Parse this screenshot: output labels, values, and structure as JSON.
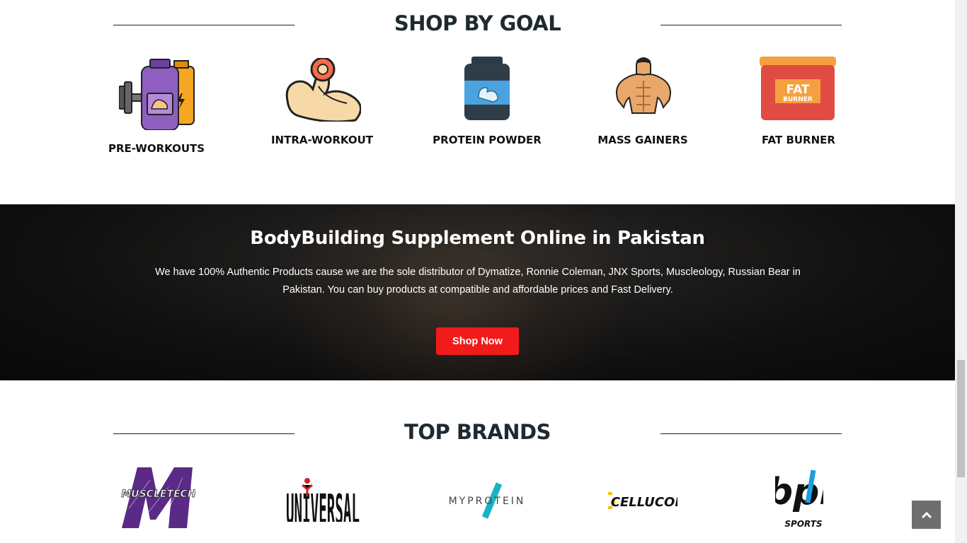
{
  "shop_by_goal": {
    "title": "SHOP BY GOAL",
    "items": [
      {
        "label": "PRE-WORKOUTS",
        "icon": "pre-workout-bottles-icon"
      },
      {
        "label": "INTRA-WORKOUT",
        "icon": "flexed-arm-icon"
      },
      {
        "label": "PROTEIN POWDER",
        "icon": "protein-tub-icon"
      },
      {
        "label": "MASS GAINERS",
        "icon": "bodybuilder-icon"
      },
      {
        "label": "FAT BURNER",
        "icon": "fat-burner-tub-icon",
        "icon_text_1": "FAT",
        "icon_text_2": "BURNER"
      }
    ]
  },
  "hero": {
    "title": "BodyBuilding Supplement Online in Pakistan",
    "description": "We have 100% Authentic Products cause we are the sole distributor of Dymatize, Ronnie Coleman, JNX Sports, Muscleology, Russian Bear in Pakistan. You can buy products at compatible and affordable prices and Fast Delivery.",
    "cta_label": "Shop Now",
    "cta_color": "#f21b1b"
  },
  "top_brands": {
    "title": "TOP BRANDS",
    "brands": [
      {
        "name": "MUSCLETECH",
        "logo": "muscletech-logo"
      },
      {
        "name": "UNIVERSAL",
        "logo": "universal-logo"
      },
      {
        "name": "MYPROTEIN",
        "logo": "myprotein-logo"
      },
      {
        "name": "CELLUCOR",
        "logo": "cellucor-logo"
      },
      {
        "name": "bpi",
        "sub": "SPORTS",
        "logo": "bpi-sports-logo"
      }
    ]
  },
  "colors": {
    "heading": "#1f2a30",
    "accent_red": "#f21b1b",
    "back_to_top": "#6e6e6e"
  },
  "back_to_top_icon": "chevron-up-icon"
}
